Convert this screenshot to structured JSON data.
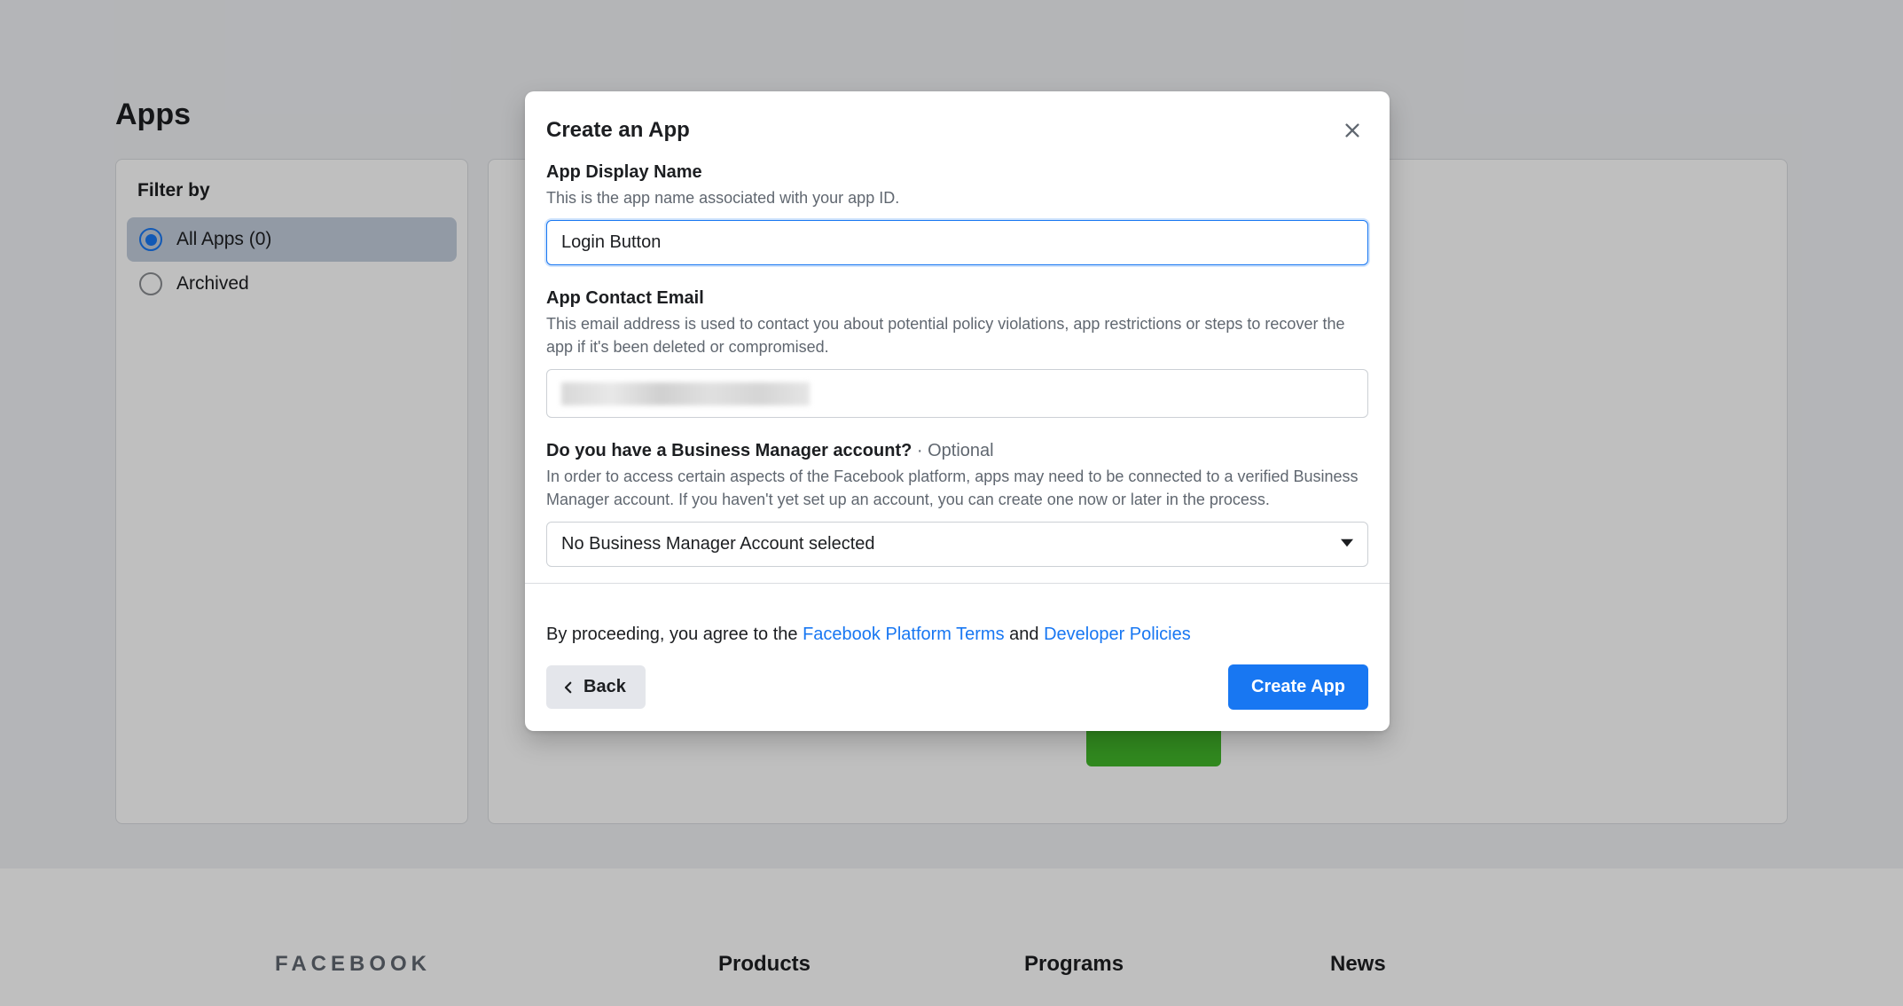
{
  "page": {
    "title": "Apps"
  },
  "sidebar": {
    "filter_label": "Filter by",
    "items": [
      {
        "label": "All Apps (0)",
        "active": true
      },
      {
        "label": "Archived",
        "active": false
      }
    ]
  },
  "footer": {
    "brand": "FACEBOOK",
    "cols": [
      "Products",
      "Programs",
      "News"
    ]
  },
  "modal": {
    "title": "Create an App",
    "fields": {
      "display_name": {
        "label": "App Display Name",
        "desc": "This is the app name associated with your app ID.",
        "value": "Login Button"
      },
      "contact_email": {
        "label": "App Contact Email",
        "desc": "This email address is used to contact you about potential policy violations, app restrictions or steps to recover the app if it's been deleted or compromised."
      },
      "business_manager": {
        "label": "Do you have a Business Manager account?",
        "optional": " · Optional",
        "desc": "In order to access certain aspects of the Facebook platform, apps may need to be connected to a verified Business Manager account. If you haven't yet set up an account, you can create one now or later in the process.",
        "selected": "No Business Manager Account selected"
      }
    },
    "terms": {
      "prefix": "By proceeding, you agree to the ",
      "link1": "Facebook Platform Terms",
      "mid": " and ",
      "link2": "Developer Policies"
    },
    "buttons": {
      "back": "Back",
      "create": "Create App"
    }
  }
}
